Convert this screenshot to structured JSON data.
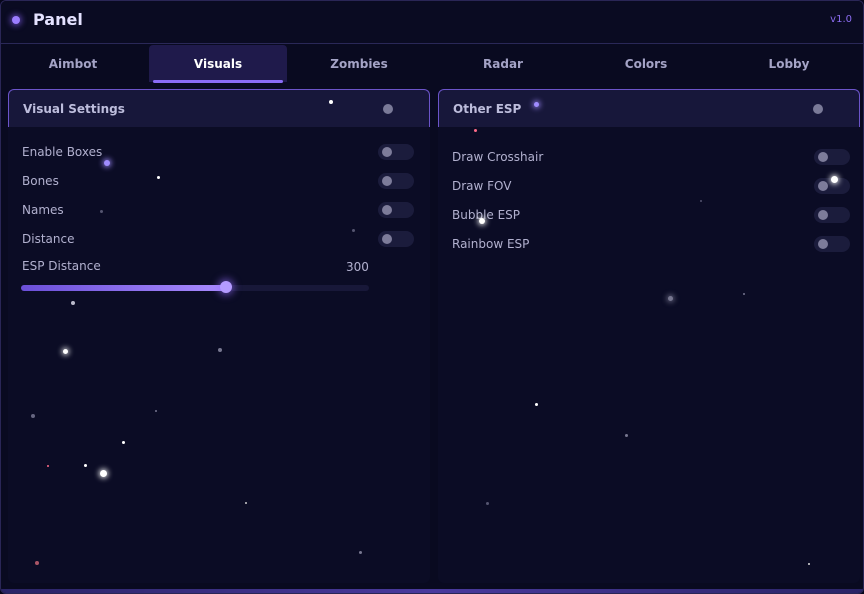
{
  "window": {
    "title": "Panel",
    "version": "v1.0",
    "accent": "#8a6cf5"
  },
  "tabs": [
    {
      "label": "Aimbot",
      "active": false
    },
    {
      "label": "Visuals",
      "active": true
    },
    {
      "label": "Zombies",
      "active": false
    },
    {
      "label": "Radar",
      "active": false
    },
    {
      "label": "Colors",
      "active": false
    },
    {
      "label": "Lobby",
      "active": false
    }
  ],
  "visual_settings": {
    "title": "Visual Settings",
    "toggles": [
      {
        "label": "Enable Boxes",
        "on": false
      },
      {
        "label": "Bones",
        "on": false
      },
      {
        "label": "Names",
        "on": false
      },
      {
        "label": "Distance",
        "on": false
      }
    ],
    "esp_distance": {
      "label": "ESP Distance",
      "value": "300",
      "fill_fraction": 0.59
    }
  },
  "other_esp": {
    "title": "Other ESP",
    "toggles": [
      {
        "label": "Draw Crosshair",
        "on": false
      },
      {
        "label": "Draw FOV",
        "on": false
      },
      {
        "label": "Bubble ESP",
        "on": false
      },
      {
        "label": "Rainbow ESP",
        "on": false
      }
    ]
  }
}
